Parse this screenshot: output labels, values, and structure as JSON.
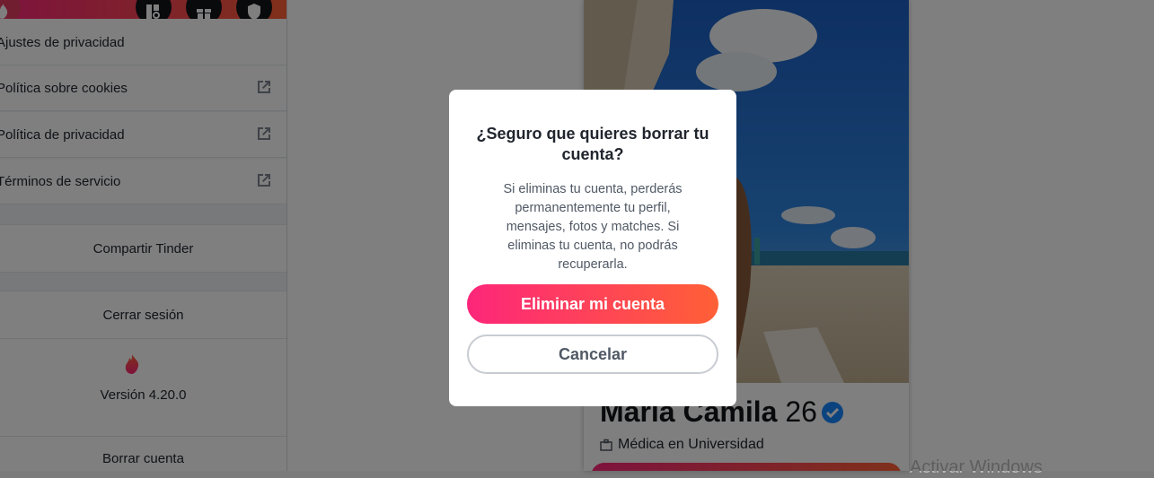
{
  "sidebar": {
    "header_buttons": [
      {
        "icon": "flame-icon"
      },
      {
        "icon": "explore-icon"
      },
      {
        "icon": "gift-icon"
      },
      {
        "icon": "shield-icon"
      }
    ],
    "rows": {
      "privacy_settings": "Ajustes de privacidad",
      "cookies": "Política sobre cookies",
      "privacy_policy": "Política de privacidad",
      "terms": "Términos de servicio",
      "share": "Compartir Tinder",
      "logout": "Cerrar sesión",
      "version": "Versión 4.20.0",
      "delete": "Borrar cuenta"
    }
  },
  "profile": {
    "name": "María Camila",
    "age": "26",
    "job": "Médica en Universidad"
  },
  "watermark": "Activar Windows",
  "dialog": {
    "title": "¿Seguro que quieres borrar tu cuenta?",
    "body": "Si eliminas tu cuenta, perderás permanentemente tu perfil, mensajes, fotos y matches. Si eliminas tu cuenta, no podrás recuperarla.",
    "confirm_label": "Eliminar mi cuenta",
    "cancel_label": "Cancelar"
  },
  "colors": {
    "brand_gradient_start": "#fd267a",
    "brand_gradient_end": "#ff6036",
    "verified_badge": "#1786ff"
  }
}
